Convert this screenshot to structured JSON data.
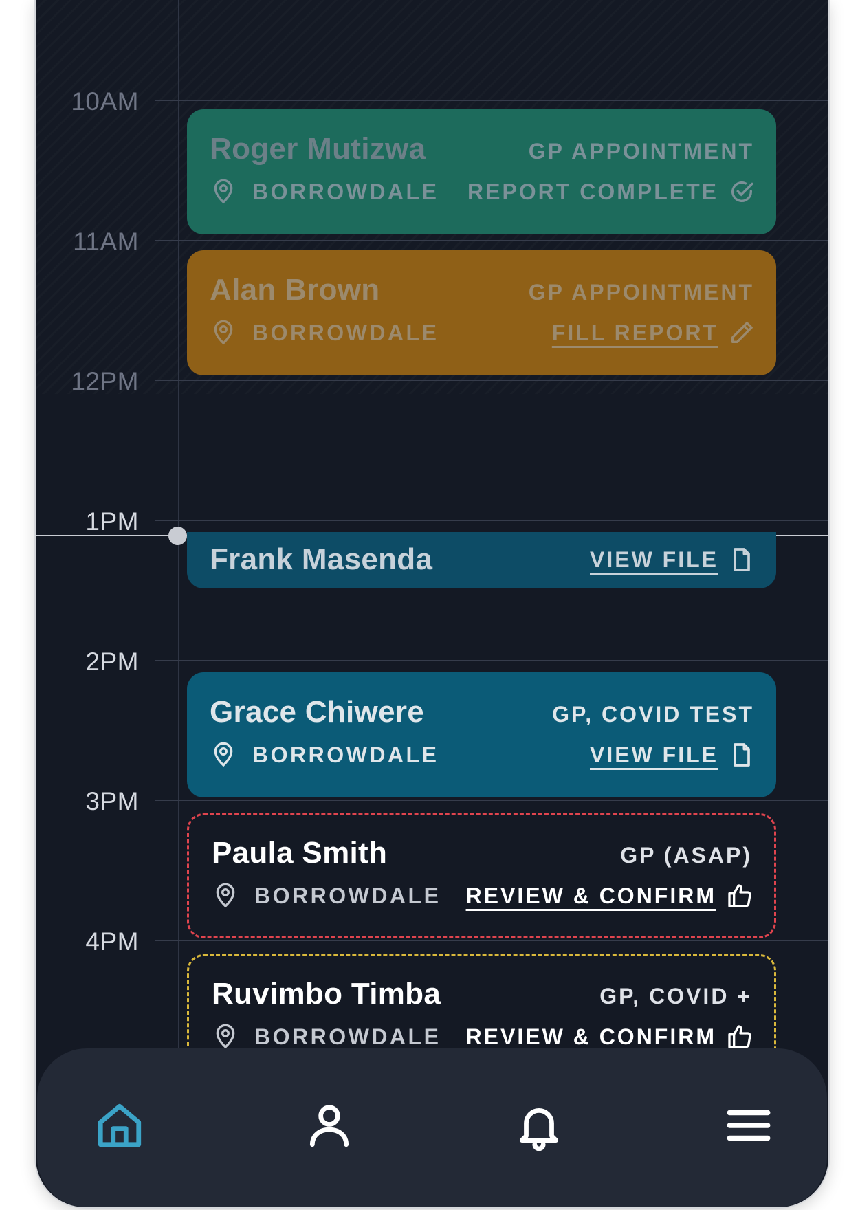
{
  "time_labels": [
    "10AM",
    "11AM",
    "12PM",
    "1PM",
    "2PM",
    "3PM",
    "4PM"
  ],
  "appointments": [
    {
      "name": "Roger Mutizwa",
      "type": "GP APPOINTMENT",
      "location": "BORROWDALE",
      "action": "REPORT COMPLETE",
      "action_icon": "check-circle-icon",
      "color": "#1d6b5c",
      "state": "past"
    },
    {
      "name": "Alan Brown",
      "type": "GP APPOINTMENT",
      "location": "BORROWDALE",
      "action": "FILL REPORT",
      "action_icon": "pencil-icon",
      "color": "#8f6017",
      "state": "past"
    },
    {
      "name": "Frank Masenda",
      "type": "",
      "location": "",
      "action": "VIEW FILE",
      "action_icon": "file-icon",
      "color": "#0d4c66",
      "state": "in-progress"
    },
    {
      "name": "Grace Chiwere",
      "type": "GP, COVID TEST",
      "location": "BORROWDALE",
      "action": "VIEW FILE",
      "action_icon": "file-icon",
      "color": "#0b5b77",
      "state": "upcoming"
    },
    {
      "name": "Paula Smith",
      "type": "GP (ASAP)",
      "location": "BORROWDALE",
      "action": "REVIEW & CONFIRM",
      "action_icon": "thumbs-up-icon",
      "color": "#e0444e",
      "state": "pending"
    },
    {
      "name": "Ruvimbo Timba",
      "type": "GP, COVID +",
      "location": "BORROWDALE",
      "action": "REVIEW & CONFIRM",
      "action_icon": "thumbs-up-icon",
      "color": "#d9b83b",
      "state": "pending"
    }
  ],
  "nav": {
    "items": [
      "home-icon",
      "user-icon",
      "bell-icon",
      "menu-icon"
    ],
    "active": "home-icon",
    "active_color": "#3ba3c7"
  }
}
